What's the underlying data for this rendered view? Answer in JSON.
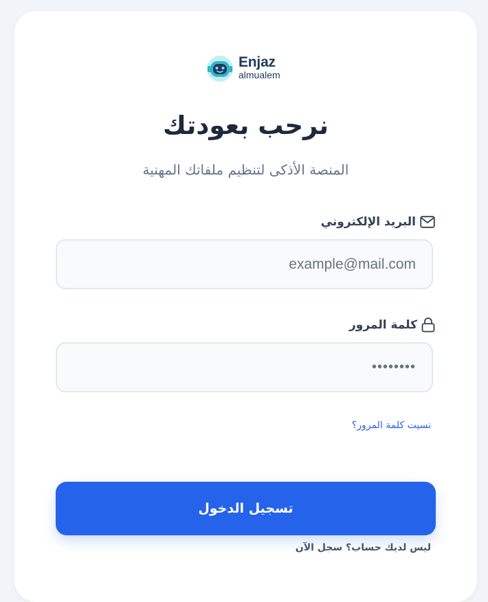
{
  "logo": {
    "name": "Enjaz",
    "subtitle": "almualem"
  },
  "heading": {
    "title": "نرحب بعودتك",
    "subtitle": "المنصة الأذكى لتنظيم ملفاتك المهنية"
  },
  "form": {
    "email": {
      "label": "البريد الإلكتروني",
      "placeholder": "example@mail.com",
      "value": ""
    },
    "password": {
      "label": "كلمة المرور",
      "value": "••••••••"
    },
    "forgot_link": "نسيت كلمة المرور؟",
    "submit_label": "تسجيل الدخول",
    "signup_text": "ليس لديك حساب؟ سجل الآن"
  },
  "colors": {
    "primary": "#2563eb",
    "title": "#1e293b",
    "muted": "#64748b",
    "field_bg": "#f8fafc",
    "field_border": "#e2e8f0",
    "logo_teal": "#33b6c9",
    "logo_navy": "#1f3a5f"
  },
  "icons": {
    "email": "mail-icon",
    "password": "lock-icon",
    "logo": "robot-icon"
  }
}
